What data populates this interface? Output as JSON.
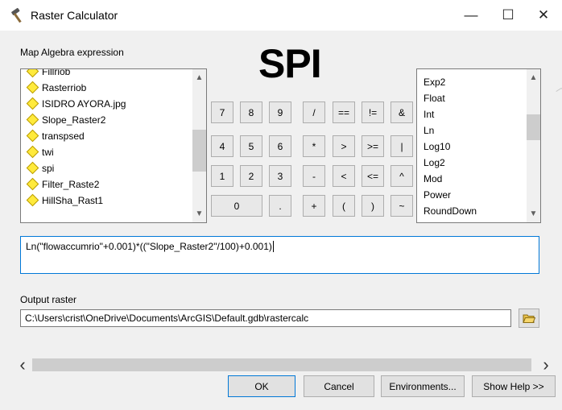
{
  "window": {
    "title": "Raster Calculator",
    "icon": "hammer-icon",
    "controls": {
      "minimize": "—",
      "maximize": "☐",
      "close": "✕"
    }
  },
  "expression_section": {
    "label": "Map Algebra expression",
    "heading": "SPI"
  },
  "layers": {
    "items": [
      "Fillriob",
      "Rasterriob",
      "ISIDRO AYORA.jpg",
      "Slope_Raster2",
      "transpsed",
      "twi",
      "spi",
      "Filter_Raste2",
      "HillSha_Rast1"
    ]
  },
  "keypad": {
    "row1": [
      "7",
      "8",
      "9",
      "/",
      "==",
      "!=",
      "&"
    ],
    "row2": [
      "4",
      "5",
      "6",
      "*",
      ">",
      ">=",
      "|"
    ],
    "row3": [
      "1",
      "2",
      "3",
      "-",
      "<",
      "<=",
      "^"
    ],
    "row4": [
      "0",
      ".",
      "+",
      "(",
      ")",
      "~"
    ]
  },
  "functions": {
    "items": [
      "Exp2",
      "Float",
      "Int",
      "Ln",
      "Log10",
      "Log2",
      "Mod",
      "Power",
      "RoundDown"
    ]
  },
  "expression": {
    "value": "Ln(\"flowaccumrio\"+0.001)*((\"Slope_Raster2\"/100)+0.001)"
  },
  "output": {
    "label": "Output raster",
    "value": "C:\\Users\\crist\\OneDrive\\Documents\\ArcGIS\\Default.gdb\\rastercalc",
    "browse_icon": "open-folder-icon"
  },
  "footer": {
    "ok": "OK",
    "cancel": "Cancel",
    "environments": "Environments...",
    "show_help": "Show Help >>"
  },
  "colors": {
    "focus_border": "#0078d7",
    "layer_diamond": "#ffea3c",
    "dialog_bg": "#f0f0f0"
  }
}
